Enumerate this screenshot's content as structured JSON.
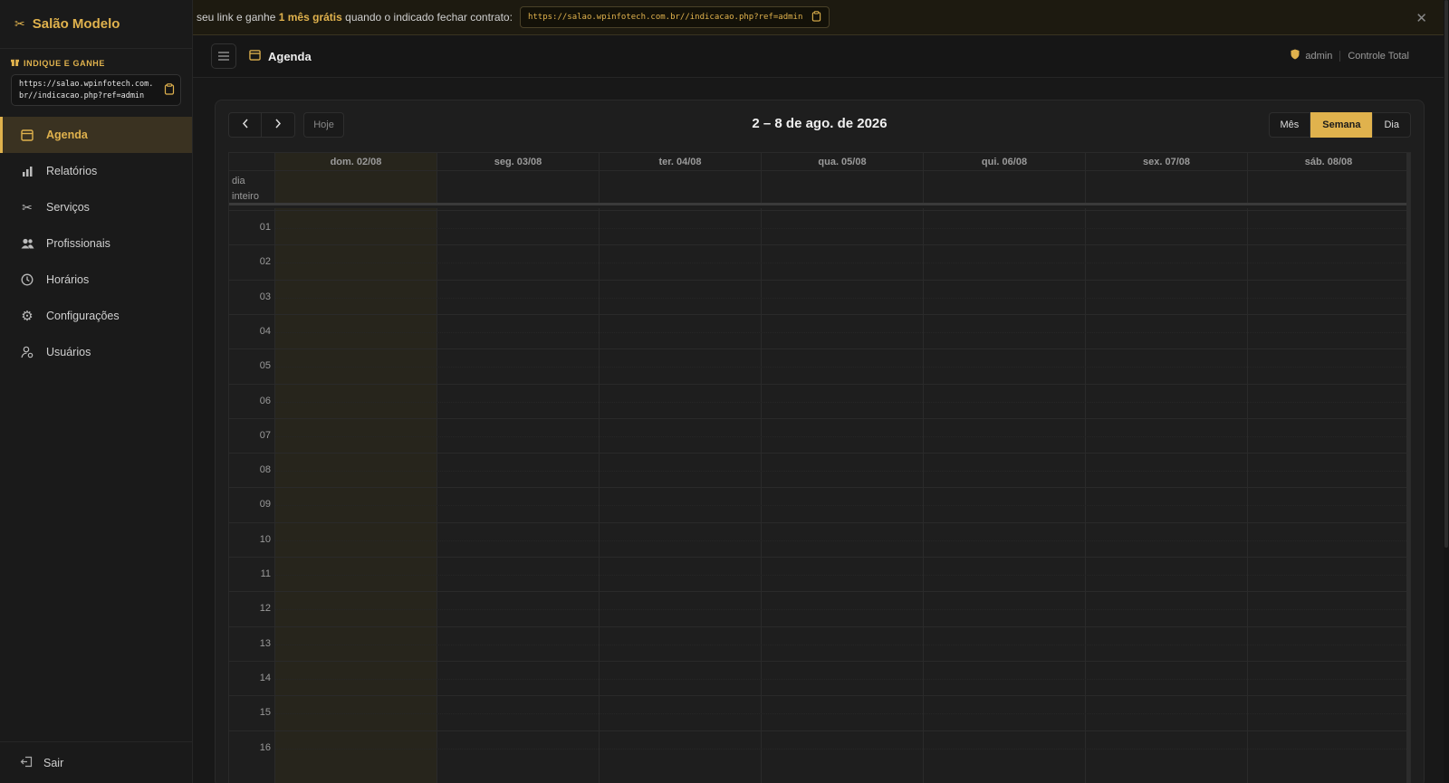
{
  "brand": {
    "name": "Salão Modelo",
    "icon": "scissors-icon"
  },
  "refer": {
    "title": "INDIQUE E GANHE",
    "url": "https://salao.wpinfotech.com.br//indicacao.php?ref=admin"
  },
  "sidebar": {
    "items": [
      {
        "label": "Agenda",
        "icon": "calendar-icon",
        "active": true
      },
      {
        "label": "Relatórios",
        "icon": "bar-chart-icon",
        "active": false
      },
      {
        "label": "Serviços",
        "icon": "scissors-icon",
        "active": false
      },
      {
        "label": "Profissionais",
        "icon": "users-icon",
        "active": false
      },
      {
        "label": "Horários",
        "icon": "clock-icon",
        "active": false
      },
      {
        "label": "Configurações",
        "icon": "gear-icon",
        "active": false
      },
      {
        "label": "Usuários",
        "icon": "user-settings-icon",
        "active": false
      }
    ],
    "logout": "Sair"
  },
  "banner": {
    "prefix": "seu link e ganhe",
    "highlight": "1 mês grátis",
    "suffix": "quando o indicado fechar contrato:",
    "url": "https://salao.wpinfotech.com.br//indicacao.php?ref=admin"
  },
  "header": {
    "title": "Agenda",
    "user": "admin",
    "role": "Controle Total"
  },
  "calendar": {
    "title": "2 – 8 de ago. de 2026",
    "today_label": "Hoje",
    "views": [
      "Mês",
      "Semana",
      "Dia"
    ],
    "active_view": "Semana",
    "allday_label_1": "dia",
    "allday_label_2": "inteiro",
    "days": [
      "dom. 02/08",
      "seg. 03/08",
      "ter. 04/08",
      "qua. 05/08",
      "qui. 06/08",
      "sex. 07/08",
      "sáb. 08/08"
    ],
    "today_index": 0,
    "hours": [
      "01",
      "02",
      "03",
      "04",
      "05",
      "06",
      "07",
      "08",
      "09",
      "10",
      "11",
      "12",
      "13",
      "14",
      "15",
      "16"
    ]
  },
  "colors": {
    "accent": "#e0b24d",
    "background": "#181818",
    "today_bg": "#27251c"
  }
}
